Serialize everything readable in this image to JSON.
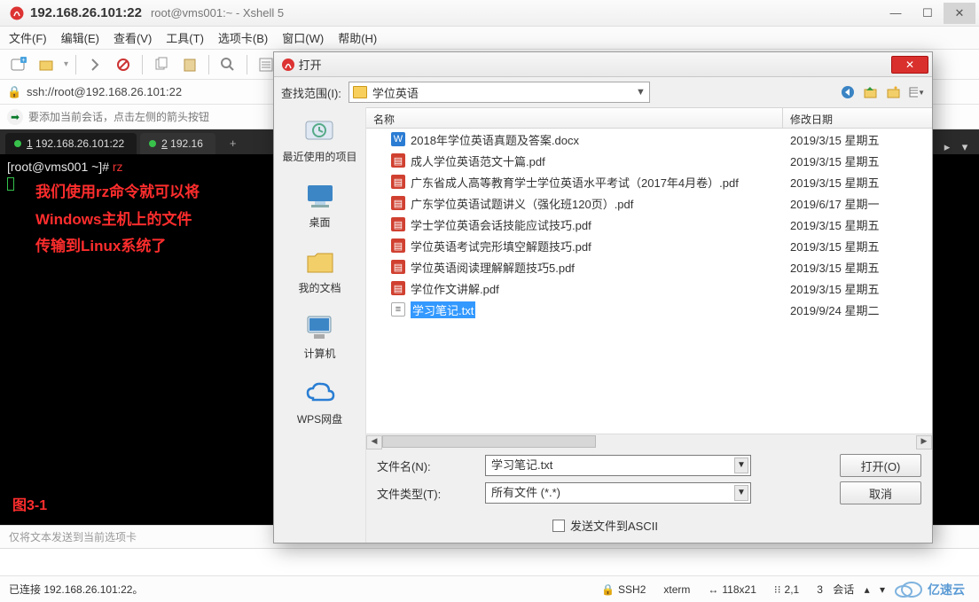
{
  "window": {
    "title_ip": "192.168.26.101:22",
    "title_sub": "root@vms001:~ - Xshell 5"
  },
  "menu": [
    "文件(F)",
    "编辑(E)",
    "查看(V)",
    "工具(T)",
    "选项卡(B)",
    "窗口(W)",
    "帮助(H)"
  ],
  "address": {
    "url": "ssh://root@192.168.26.101:22"
  },
  "hint": "要添加当前会话，点击左侧的箭头按钮",
  "tabs": {
    "items": [
      {
        "num": "1",
        "label": "192.168.26.101:22"
      },
      {
        "num": "2",
        "label": "192.16"
      }
    ]
  },
  "terminal": {
    "prompt": "[root@vms001 ~]#",
    "command": "rz"
  },
  "annotation": {
    "l1": "我们使用rz命令就可以将",
    "l2": "Windows主机上的文件",
    "l3": "传输到Linux系统了",
    "figure": "图3-1"
  },
  "inputrow_placeholder": "仅将文本发送到当前选项卡",
  "status": {
    "left": "已连接 192.168.26.101:22。",
    "ssh": "SSH2",
    "term": "xterm",
    "size": "118x21",
    "pos": "2,1",
    "sessions_label": "会话",
    "sessions_count": "3",
    "brand": "亿速云"
  },
  "dialog": {
    "title": "打开",
    "lookin_label": "查找范围(I):",
    "folder": "学位英语",
    "cols": {
      "name": "名称",
      "date": "修改日期"
    },
    "places": [
      "最近使用的项目",
      "桌面",
      "我的文档",
      "计算机",
      "WPS网盘"
    ],
    "files": [
      {
        "icon": "ico-docx",
        "name": "2018年学位英语真题及答案.docx",
        "date": "2019/3/15 星期五"
      },
      {
        "icon": "ico-pdf",
        "name": "成人学位英语范文十篇.pdf",
        "date": "2019/3/15 星期五"
      },
      {
        "icon": "ico-pdf",
        "name": "广东省成人高等教育学士学位英语水平考试（2017年4月卷）.pdf",
        "date": "2019/3/15 星期五"
      },
      {
        "icon": "ico-pdf",
        "name": "广东学位英语试题讲义（强化班120页）.pdf",
        "date": "2019/6/17 星期一"
      },
      {
        "icon": "ico-pdf",
        "name": "学士学位英语会话技能应试技巧.pdf",
        "date": "2019/3/15 星期五"
      },
      {
        "icon": "ico-pdf",
        "name": "学位英语考试完形填空解题技巧.pdf",
        "date": "2019/3/15 星期五"
      },
      {
        "icon": "ico-pdf",
        "name": "学位英语阅读理解解题技巧5.pdf",
        "date": "2019/3/15 星期五"
      },
      {
        "icon": "ico-pdf",
        "name": "学位作文讲解.pdf",
        "date": "2019/3/15 星期五"
      },
      {
        "icon": "ico-txt",
        "name": "学习笔记.txt",
        "date": "2019/9/24 星期二",
        "selected": true
      }
    ],
    "filename_label": "文件名(N):",
    "filename_value": "学习笔记.txt",
    "filetype_label": "文件类型(T):",
    "filetype_value": "所有文件 (*.*)",
    "open_btn": "打开(O)",
    "cancel_btn": "取消",
    "ascii_label": "发送文件到ASCII"
  }
}
